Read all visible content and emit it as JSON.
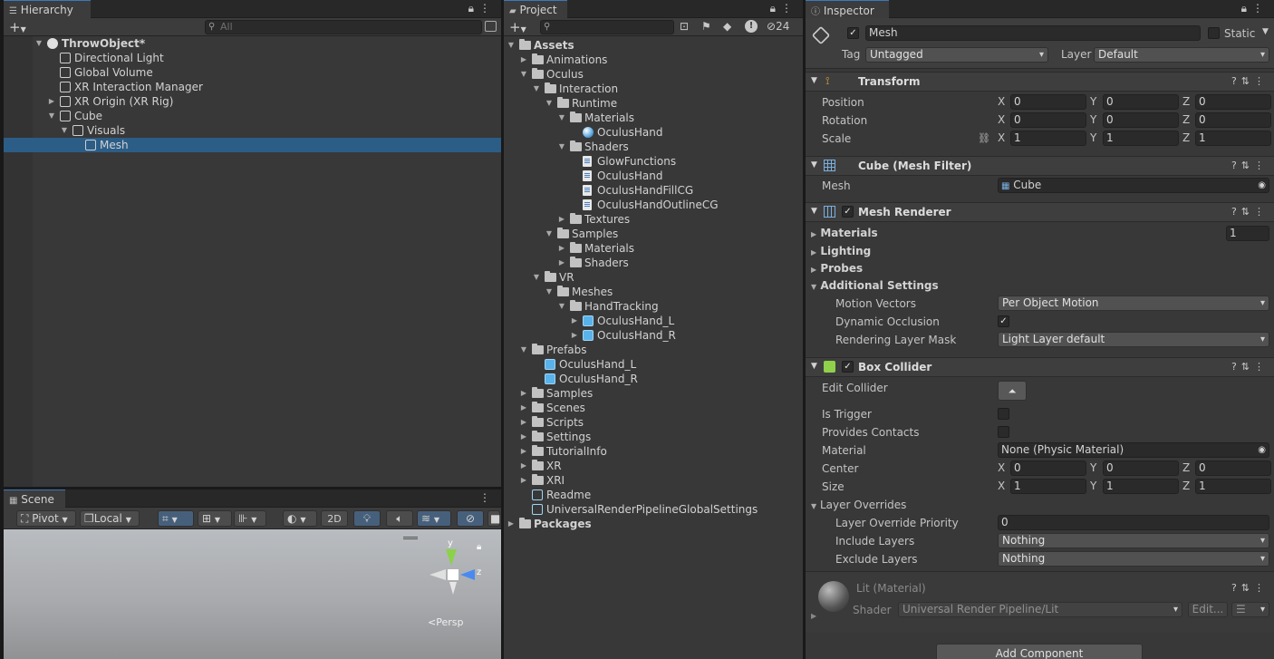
{
  "hierarchy": {
    "tab": "Hierarchy",
    "add": "+",
    "search_placeholder": "All",
    "rows": [
      {
        "label": "ThrowObject*",
        "indent": 0,
        "arrow": "▼",
        "icon": "unity-scene-icon",
        "bold": true
      },
      {
        "label": "Directional Light",
        "indent": 1,
        "arrow": "",
        "icon": "gameobject-icon"
      },
      {
        "label": "Global Volume",
        "indent": 1,
        "arrow": "",
        "icon": "gameobject-icon"
      },
      {
        "label": "XR Interaction Manager",
        "indent": 1,
        "arrow": "",
        "icon": "gameobject-icon"
      },
      {
        "label": "XR Origin (XR Rig)",
        "indent": 1,
        "arrow": "▶",
        "icon": "gameobject-icon"
      },
      {
        "label": "Cube",
        "indent": 1,
        "arrow": "▼",
        "icon": "gameobject-icon"
      },
      {
        "label": "Visuals",
        "indent": 2,
        "arrow": "▼",
        "icon": "gameobject-icon"
      },
      {
        "label": "Mesh",
        "indent": 3,
        "arrow": "",
        "icon": "gameobject-icon",
        "selected": true
      }
    ]
  },
  "scene": {
    "tab": "Scene",
    "pivot": "Pivot",
    "local": "Local",
    "mode_2d": "2D",
    "persp": "Persp",
    "gizmo_y": "y",
    "gizmo_z": "z"
  },
  "project": {
    "tab": "Project",
    "hidden_count": "24",
    "rows": [
      {
        "label": "Assets",
        "indent": 0,
        "arrow": "▼",
        "icon": "folder-icon",
        "bold": true
      },
      {
        "label": "Animations",
        "indent": 1,
        "arrow": "▶",
        "icon": "folder-icon"
      },
      {
        "label": "Oculus",
        "indent": 1,
        "arrow": "▼",
        "icon": "folder-icon"
      },
      {
        "label": "Interaction",
        "indent": 2,
        "arrow": "▼",
        "icon": "folder-icon"
      },
      {
        "label": "Runtime",
        "indent": 3,
        "arrow": "▼",
        "icon": "folder-icon"
      },
      {
        "label": "Materials",
        "indent": 4,
        "arrow": "▼",
        "icon": "folder-icon"
      },
      {
        "label": "OculusHand",
        "indent": 5,
        "arrow": "",
        "icon": "material-icon"
      },
      {
        "label": "Shaders",
        "indent": 4,
        "arrow": "▼",
        "icon": "folder-icon"
      },
      {
        "label": "GlowFunctions",
        "indent": 5,
        "arrow": "",
        "icon": "file-icon"
      },
      {
        "label": "OculusHand",
        "indent": 5,
        "arrow": "",
        "icon": "shader-icon"
      },
      {
        "label": "OculusHandFillCG",
        "indent": 5,
        "arrow": "",
        "icon": "file-icon"
      },
      {
        "label": "OculusHandOutlineCG",
        "indent": 5,
        "arrow": "",
        "icon": "file-icon"
      },
      {
        "label": "Textures",
        "indent": 4,
        "arrow": "▶",
        "icon": "folder-icon"
      },
      {
        "label": "Samples",
        "indent": 3,
        "arrow": "▼",
        "icon": "folder-icon"
      },
      {
        "label": "Materials",
        "indent": 4,
        "arrow": "▶",
        "icon": "folder-icon"
      },
      {
        "label": "Shaders",
        "indent": 4,
        "arrow": "▶",
        "icon": "folder-icon"
      },
      {
        "label": "VR",
        "indent": 2,
        "arrow": "▼",
        "icon": "folder-icon"
      },
      {
        "label": "Meshes",
        "indent": 3,
        "arrow": "▼",
        "icon": "folder-icon"
      },
      {
        "label": "HandTracking",
        "indent": 4,
        "arrow": "▼",
        "icon": "folder-icon"
      },
      {
        "label": "OculusHand_L",
        "indent": 5,
        "arrow": "▶",
        "icon": "model-icon"
      },
      {
        "label": "OculusHand_R",
        "indent": 5,
        "arrow": "▶",
        "icon": "model-icon"
      },
      {
        "label": "Prefabs",
        "indent": 1,
        "arrow": "▼",
        "icon": "folder-icon"
      },
      {
        "label": "OculusHand_L",
        "indent": 2,
        "arrow": "",
        "icon": "prefab-icon"
      },
      {
        "label": "OculusHand_R",
        "indent": 2,
        "arrow": "",
        "icon": "prefab-icon"
      },
      {
        "label": "Samples",
        "indent": 1,
        "arrow": "▶",
        "icon": "folder-icon"
      },
      {
        "label": "Scenes",
        "indent": 1,
        "arrow": "▶",
        "icon": "folder-icon"
      },
      {
        "label": "Scripts",
        "indent": 1,
        "arrow": "▶",
        "icon": "folder-icon"
      },
      {
        "label": "Settings",
        "indent": 1,
        "arrow": "▶",
        "icon": "folder-icon"
      },
      {
        "label": "TutorialInfo",
        "indent": 1,
        "arrow": "▶",
        "icon": "folder-icon"
      },
      {
        "label": "XR",
        "indent": 1,
        "arrow": "▶",
        "icon": "folder-icon"
      },
      {
        "label": "XRI",
        "indent": 1,
        "arrow": "▶",
        "icon": "folder-icon"
      },
      {
        "label": "Readme",
        "indent": 1,
        "arrow": "",
        "icon": "scriptable-object-icon"
      },
      {
        "label": "UniversalRenderPipelineGlobalSettings",
        "indent": 1,
        "arrow": "",
        "icon": "scriptable-object-icon"
      },
      {
        "label": "Packages",
        "indent": 0,
        "arrow": "▶",
        "icon": "folder-icon",
        "bold": true
      }
    ]
  },
  "inspector": {
    "tab": "Inspector",
    "object_name": "Mesh",
    "static_label": "Static",
    "tag_label": "Tag",
    "tag_value": "Untagged",
    "layer_label": "Layer",
    "layer_value": "Default",
    "transform": {
      "title": "Transform",
      "position_label": "Position",
      "rotation_label": "Rotation",
      "scale_label": "Scale",
      "position": {
        "x": "0",
        "y": "0",
        "z": "0"
      },
      "rotation": {
        "x": "0",
        "y": "0",
        "z": "0"
      },
      "scale": {
        "x": "1",
        "y": "1",
        "z": "1"
      },
      "axis_x": "X",
      "axis_y": "Y",
      "axis_z": "Z"
    },
    "mesh_filter": {
      "title": "Cube (Mesh Filter)",
      "mesh_label": "Mesh",
      "mesh_value": "Cube"
    },
    "mesh_renderer": {
      "title": "Mesh Renderer",
      "materials_label": "Materials",
      "materials_count": "1",
      "lighting_label": "Lighting",
      "probes_label": "Probes",
      "additional_label": "Additional Settings",
      "motion_vectors_label": "Motion Vectors",
      "motion_vectors_value": "Per Object Motion",
      "dynamic_occlusion_label": "Dynamic Occlusion",
      "rendering_layer_label": "Rendering Layer Mask",
      "rendering_layer_value": "Light Layer default"
    },
    "box_collider": {
      "title": "Box Collider",
      "edit_collider_label": "Edit Collider",
      "is_trigger_label": "Is Trigger",
      "provides_contacts_label": "Provides Contacts",
      "material_label": "Material",
      "material_value": "None (Physic Material)",
      "center_label": "Center",
      "size_label": "Size",
      "center": {
        "x": "0",
        "y": "0",
        "z": "0"
      },
      "size": {
        "x": "1",
        "y": "1",
        "z": "1"
      },
      "layer_overrides_label": "Layer Overrides",
      "override_priority_label": "Layer Override Priority",
      "override_priority_value": "0",
      "include_layers_label": "Include Layers",
      "include_layers_value": "Nothing",
      "exclude_layers_label": "Exclude Layers",
      "exclude_layers_value": "Nothing"
    },
    "material": {
      "title": "Lit (Material)",
      "shader_label": "Shader",
      "shader_value": "Universal Render Pipeline/Lit",
      "edit_label": "Edit..."
    },
    "add_component": "Add Component"
  },
  "colors": {
    "selection": "#2c5d87",
    "accent_tab": "#3a79bb",
    "panel": "#383838"
  }
}
